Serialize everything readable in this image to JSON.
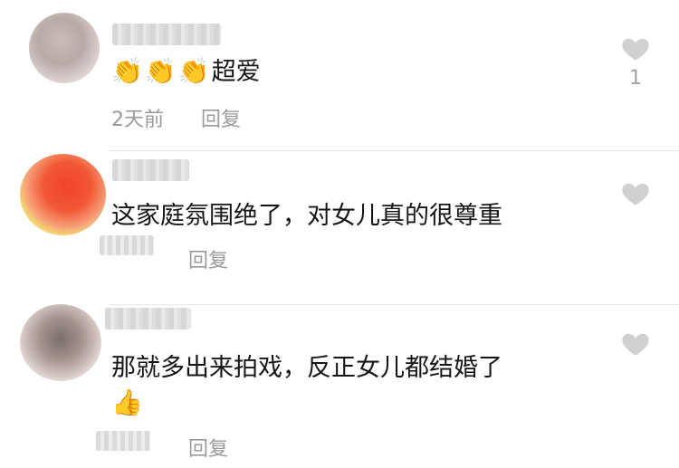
{
  "comments": [
    {
      "emojis": [
        "👏",
        "👏",
        "👏"
      ],
      "text": "超爱",
      "time": "2天前",
      "reply": "回复",
      "likes": "1",
      "like_icon": "heart-outline-icon"
    },
    {
      "text": "这家庭氛围绝了，对女儿真的很尊重",
      "reply": "回复",
      "like_icon": "heart-outline-icon"
    },
    {
      "text": "那就多出来拍戏，反正女儿都结婚了",
      "emoji_after": "👍",
      "reply": "回复",
      "like_icon": "heart-outline-icon"
    }
  ],
  "colors": {
    "text": "#161616",
    "meta": "#9a9a9a",
    "heart": "#cfcfcf"
  }
}
